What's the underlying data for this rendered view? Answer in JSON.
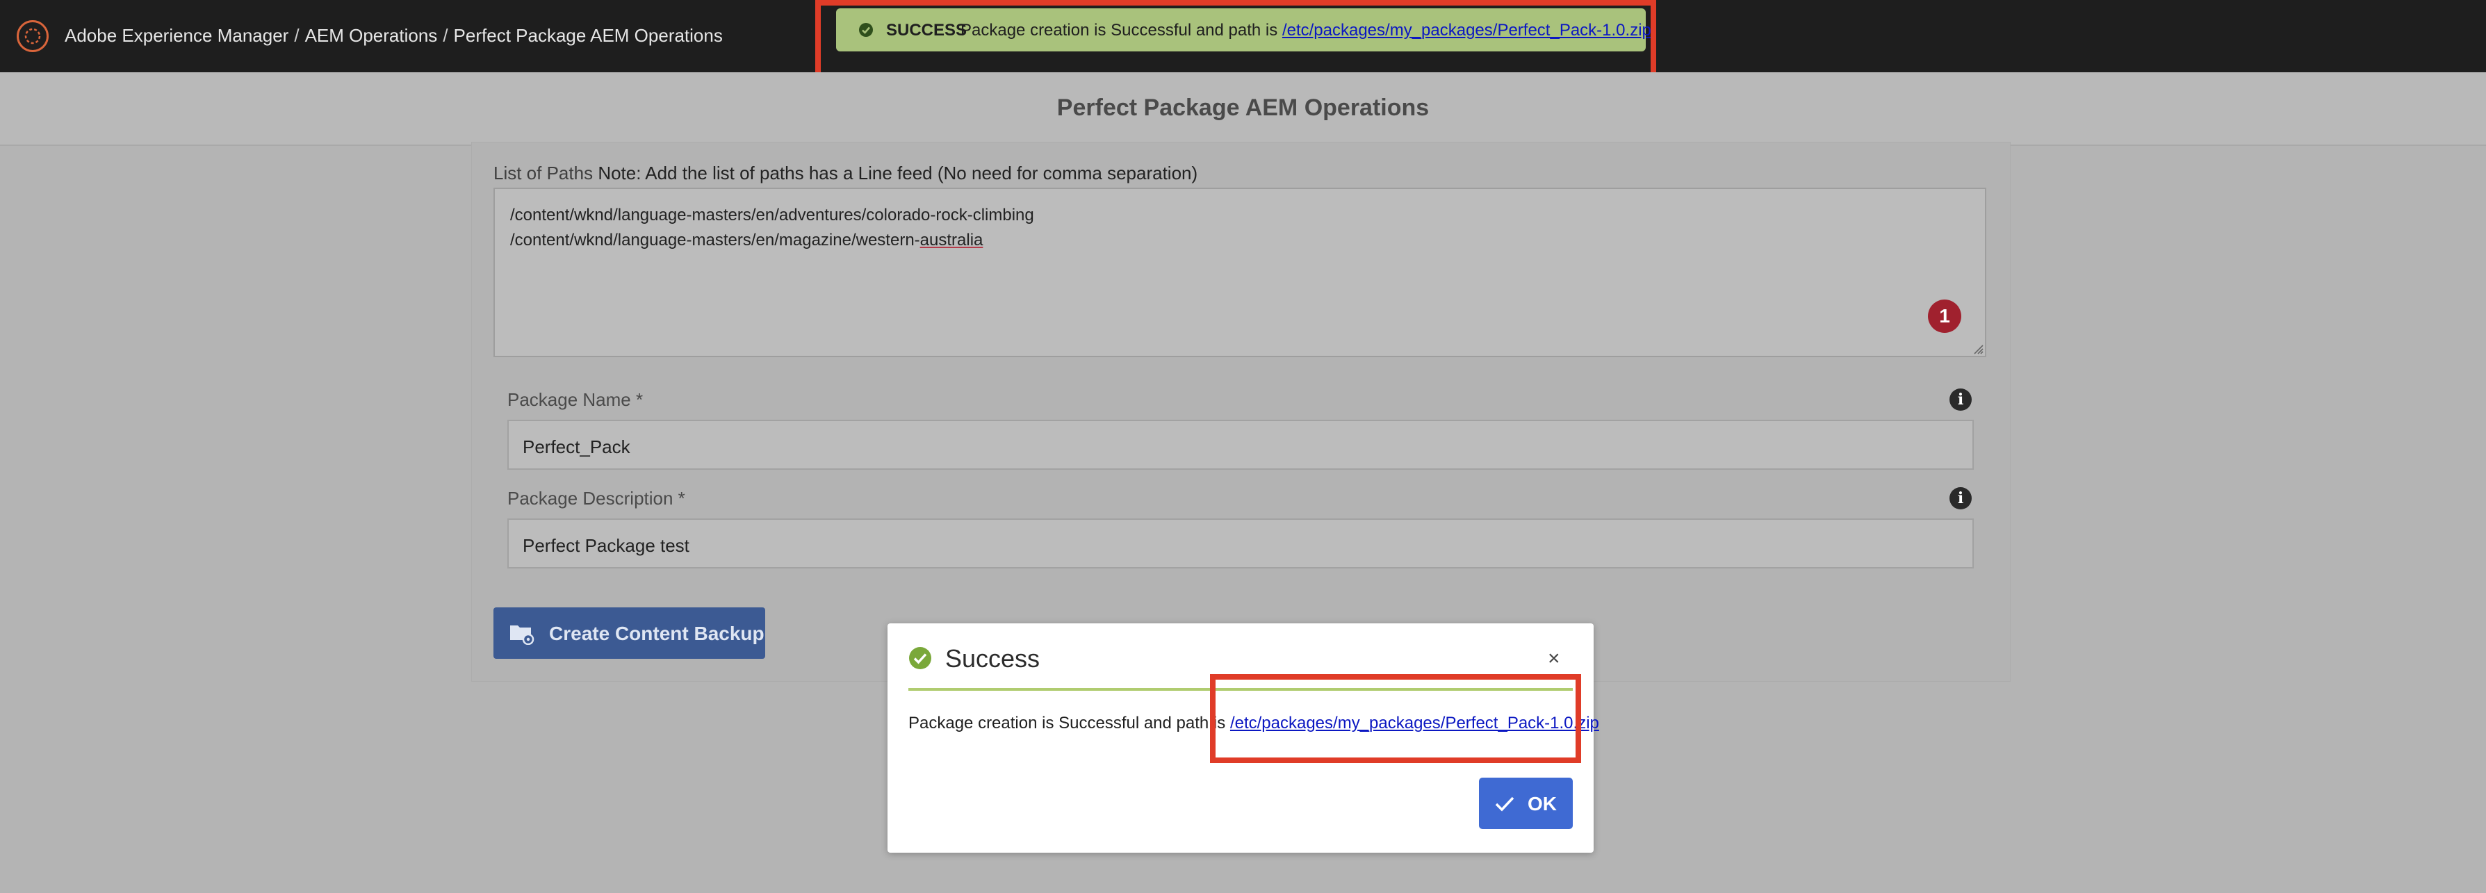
{
  "breadcrumb": {
    "items": [
      "Adobe Experience Manager",
      "AEM Operations",
      "Perfect Package AEM Operations"
    ],
    "separator": "/"
  },
  "toast": {
    "status": "SUCCESS",
    "message": "Package creation is Successful and path is",
    "link": "/etc/packages/my_packages/Perfect_Pack-1.0.zip",
    "background_color": "#a9c27c"
  },
  "page": {
    "title": "Perfect Package AEM Operations"
  },
  "form": {
    "paths_label": "List of Paths",
    "paths_note": "Note: Add the list of paths has a Line feed (No need for comma separation)",
    "paths": [
      "/content/wknd/language-masters/en/adventures/colorado-rock-climbing",
      "/content/wknd/language-masters/en/magazine/western-australia"
    ],
    "paths_line2_prefix": "/content/wknd/language-masters/en/magazine/western-",
    "paths_line2_misspelled": "australia",
    "error_count": "1",
    "package_name_label": "Package Name *",
    "package_name_value": "Perfect_Pack",
    "package_description_label": "Package Description *",
    "package_description_value": "Perfect Package test",
    "backup_button": "Create Content Backup",
    "info_glyph": "i"
  },
  "dialog": {
    "title": "Success",
    "close_glyph": "×",
    "message": "Package creation is Successful and path is",
    "link": "/etc/packages/my_packages/Perfect_Pack-1.0.zip",
    "ok_button": "OK",
    "accent_color": "#b0cc70"
  },
  "colors": {
    "highlight": "#e03c28",
    "primary_button": "#3f6ad3",
    "topbar": "#1e1e1e",
    "error_badge": "#a0212e"
  },
  "icons": [
    "aem-logo-icon",
    "check-circle-icon",
    "folder-gear-icon",
    "info-icon",
    "close-icon",
    "checkmark-icon",
    "resize-grip-icon"
  ]
}
